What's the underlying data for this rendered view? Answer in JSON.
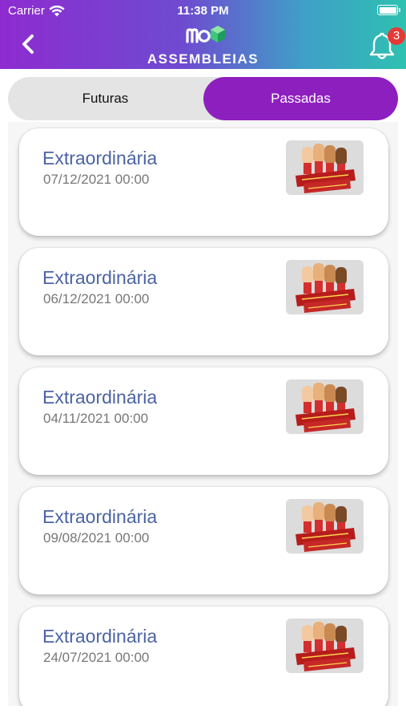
{
  "status_bar": {
    "carrier": "Carrier",
    "time": "11:38 PM"
  },
  "header": {
    "title": "ASSEMBLEIAS",
    "notification_count": "3"
  },
  "tabs": {
    "futuras": "Futuras",
    "passadas": "Passadas",
    "active": "Passadas"
  },
  "colors": {
    "accent": "#8e1fbf",
    "title_blue": "#4b63a6",
    "badge_red": "#e53935"
  },
  "assemblies": [
    {
      "title": "Extraordinária",
      "date": "07/12/2021 00:00",
      "image": "assembleia-geral-extraordinaria"
    },
    {
      "title": "Extraordinária",
      "date": "06/12/2021 00:00",
      "image": "assembleia-geral-extraordinaria"
    },
    {
      "title": "Extraordinária",
      "date": "04/11/2021 00:00",
      "image": "assembleia-geral-extraordinaria"
    },
    {
      "title": "Extraordinária",
      "date": "09/08/2021 00:00",
      "image": "assembleia-geral-extraordinaria"
    },
    {
      "title": "Extraordinária",
      "date": "24/07/2021 00:00",
      "image": "assembleia-geral-extraordinaria"
    }
  ]
}
